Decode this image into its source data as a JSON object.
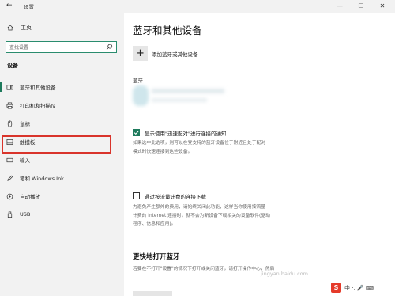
{
  "window": {
    "back_glyph": "←",
    "title": "设置",
    "controls": {
      "minimize": "—",
      "maximize": "☐",
      "close": "✕"
    }
  },
  "sidebar": {
    "home_label": "主页",
    "search_placeholder": "查找设置",
    "section_label": "设备",
    "items": [
      {
        "label": "蓝牙和其他设备",
        "icon": "bluetooth-devices-icon",
        "active": true
      },
      {
        "label": "打印机和扫描仪",
        "icon": "printer-icon",
        "active": false
      },
      {
        "label": "鼠标",
        "icon": "mouse-icon",
        "active": false
      },
      {
        "label": "触摸板",
        "icon": "touchpad-icon",
        "active": false
      },
      {
        "label": "输入",
        "icon": "keyboard-icon",
        "active": false
      },
      {
        "label": "笔和 Windows Ink",
        "icon": "pen-icon",
        "active": false
      },
      {
        "label": "自动播放",
        "icon": "autoplay-icon",
        "active": false
      },
      {
        "label": "USB",
        "icon": "usb-icon",
        "active": false
      }
    ],
    "highlighted_item": "触摸板",
    "highlight_color": "#d9342b"
  },
  "main": {
    "page_title": "蓝牙和其他设备",
    "add_button_glyph": "+",
    "add_label": "添加蓝牙或其他设备",
    "bluetooth_label": "蓝牙",
    "swift_pair": {
      "checked": true,
      "label": "显示使用\"迅速配对\"进行连接的通知",
      "desc_line1": "如果选中此选项，则可以在受支持的蓝牙设备位于附近且处于配对",
      "desc_line2": "模式时快速连接到这些设备。"
    },
    "metered": {
      "checked": false,
      "label": "通过按流量计费的连接下载",
      "desc_line1": "为避免产生额外的费用，请始终关闭此功能，这样当你使用按流量",
      "desc_line2": "计费的 Internet 连接时，就不会为新设备下载相关的设备软件(驱动",
      "desc_line3": "程序、信息和应用)。"
    },
    "quick_open": {
      "title": "更快地打开蓝牙",
      "desc": "若要在不打开\"设置\"的情况下打开或关闭蓝牙，请打开操作中心，然后"
    }
  },
  "overlay": {
    "watermark": "jingyan.baidu.com",
    "brand_badge": "S",
    "brand_text": "中 ·, 🎤 ⌨"
  },
  "colors": {
    "accent": "#1e7a5c",
    "search_border": "#2a8c6e",
    "sidebar_bg": "#f2f2f2"
  }
}
